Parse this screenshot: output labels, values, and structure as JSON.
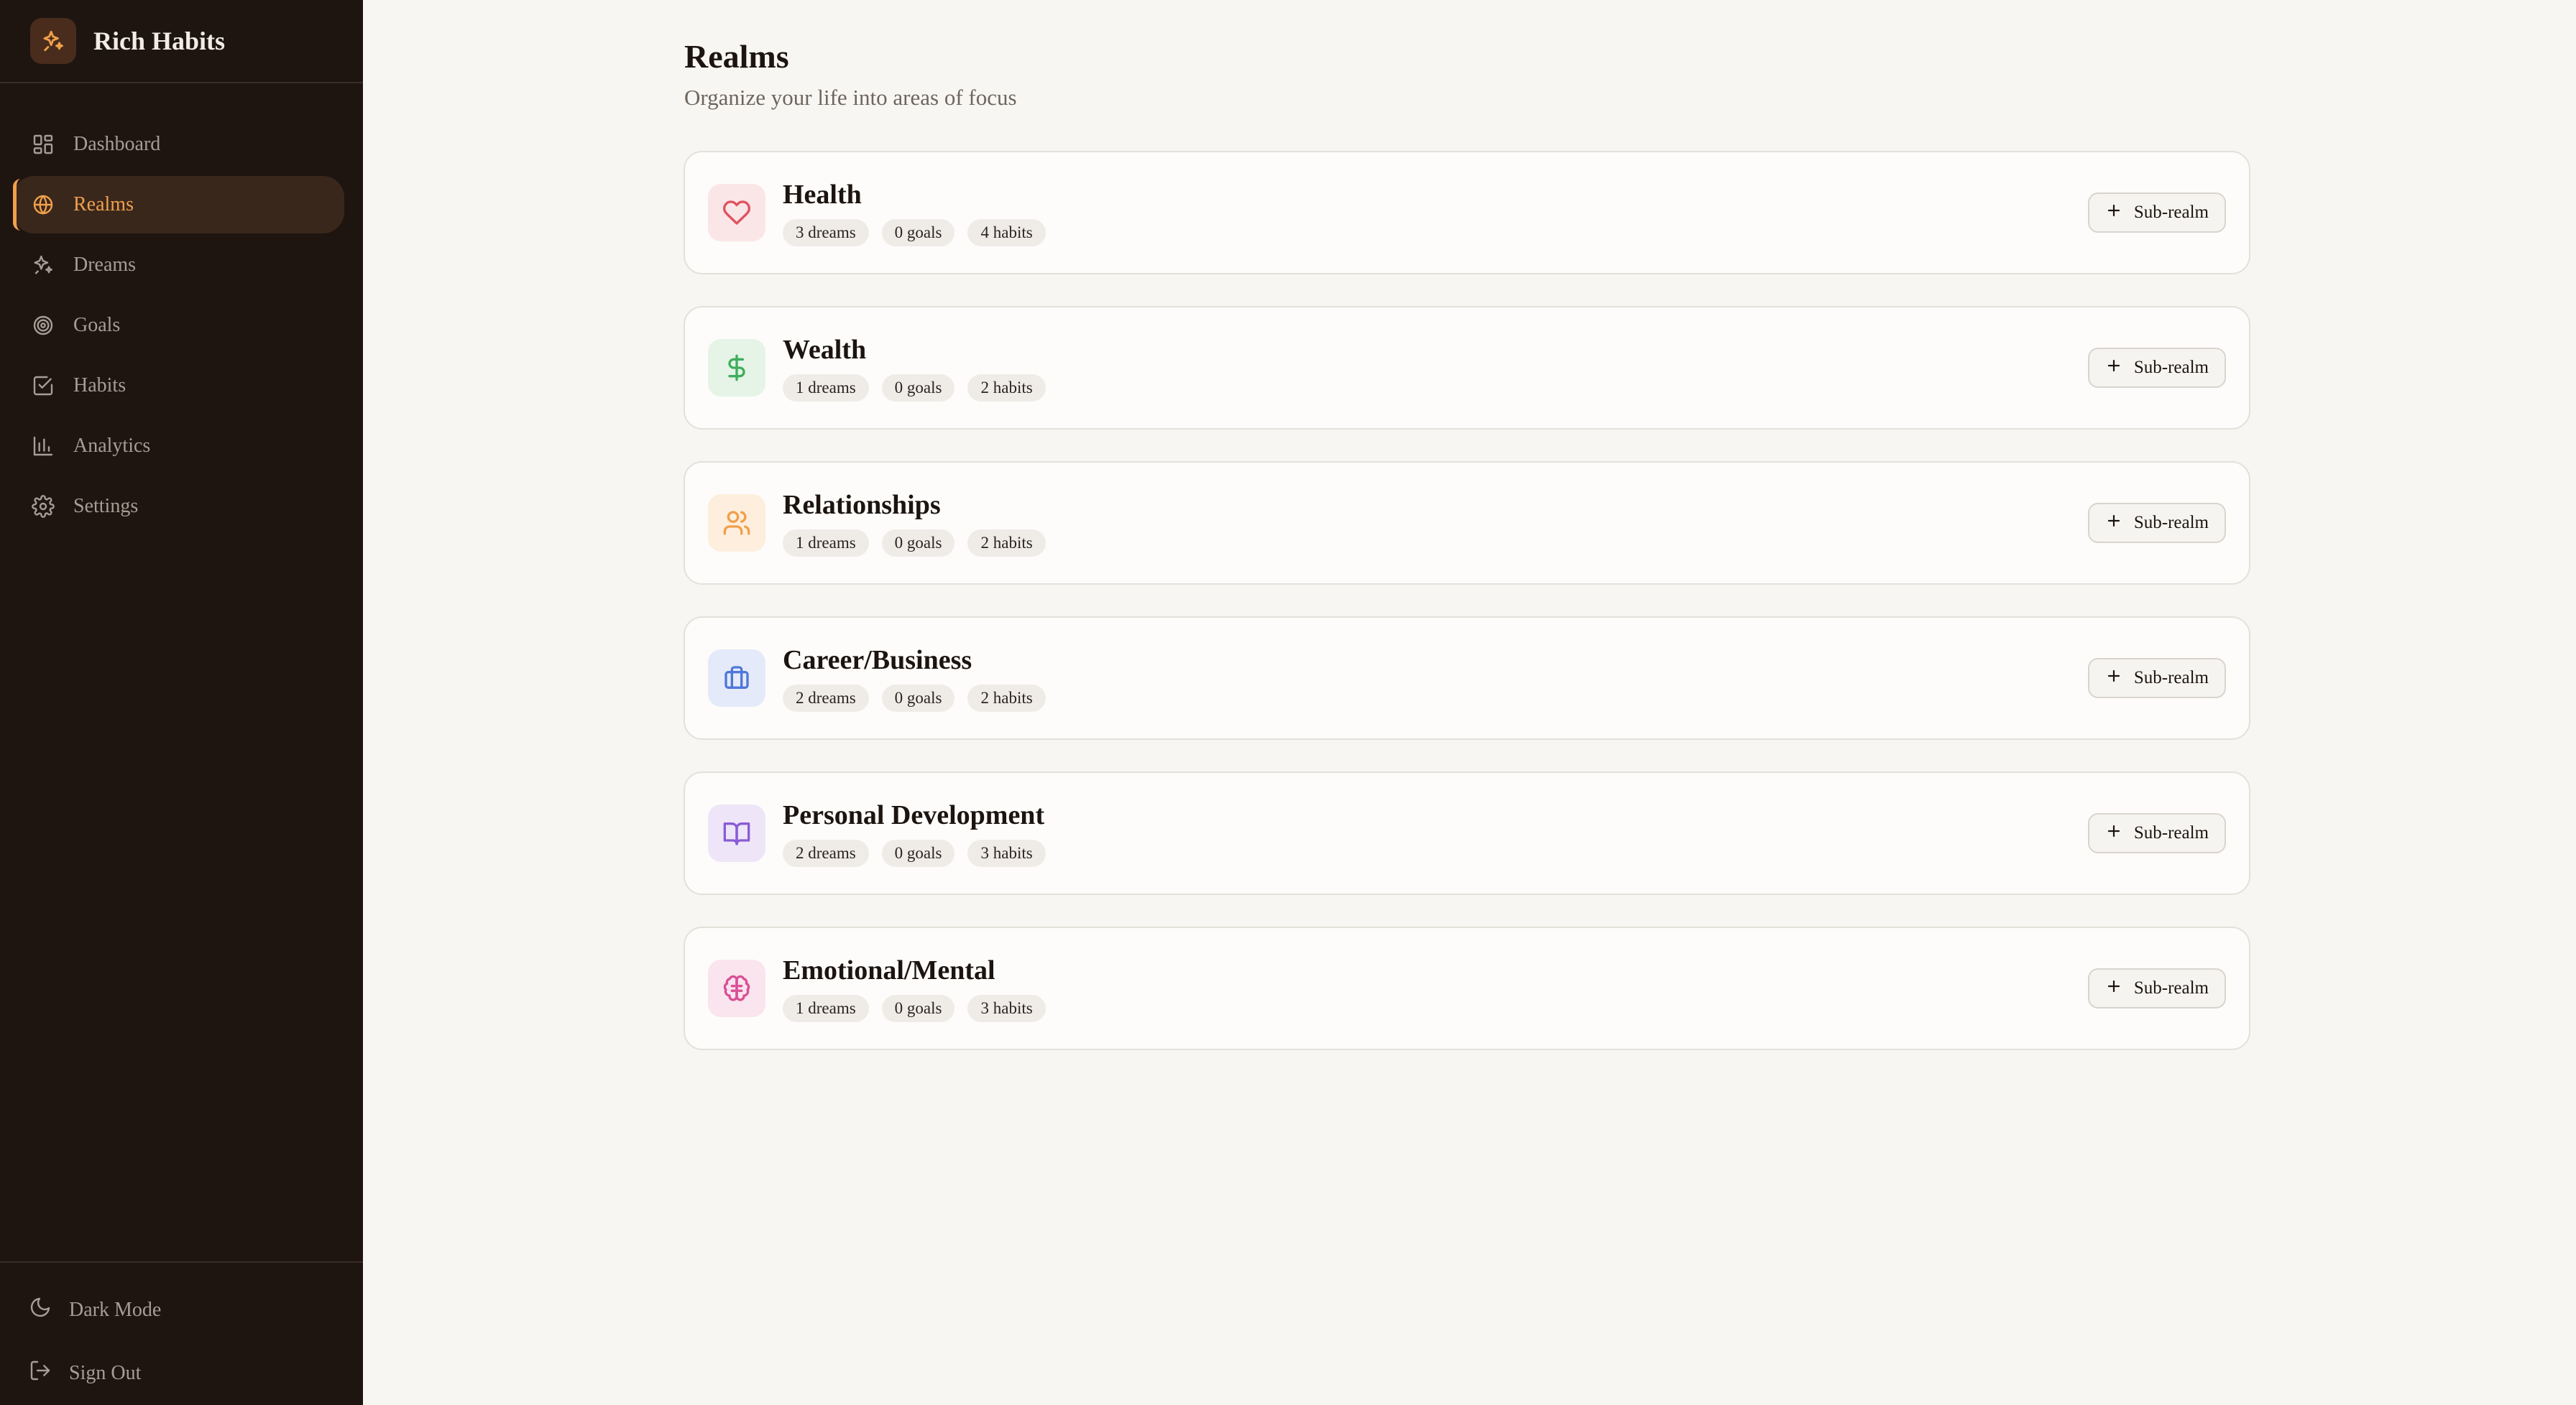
{
  "brand": {
    "name": "Rich Habits",
    "icon": "sparkles-icon"
  },
  "nav": [
    {
      "label": "Dashboard",
      "icon": "layout-dashboard-icon",
      "active": false
    },
    {
      "label": "Realms",
      "icon": "globe-icon",
      "active": true
    },
    {
      "label": "Dreams",
      "icon": "sparkles-icon",
      "active": false
    },
    {
      "label": "Goals",
      "icon": "target-icon",
      "active": false
    },
    {
      "label": "Habits",
      "icon": "check-square-icon",
      "active": false
    },
    {
      "label": "Analytics",
      "icon": "bar-chart-icon",
      "active": false
    },
    {
      "label": "Settings",
      "icon": "gear-icon",
      "active": false
    }
  ],
  "bottom": {
    "dark_mode": "Dark Mode",
    "sign_out": "Sign Out"
  },
  "page": {
    "title": "Realms",
    "subtitle": "Organize your life into areas of focus"
  },
  "sub_realm_label": "Sub-realm",
  "realms": [
    {
      "name": "Health",
      "icon": "heart-icon",
      "color": "#e0525f",
      "bg": "#fbe6e7",
      "dreams": "3 dreams",
      "goals": "0 goals",
      "habits": "4 habits"
    },
    {
      "name": "Wealth",
      "icon": "dollar-icon",
      "color": "#3fae5d",
      "bg": "#e5f4e7",
      "dreams": "1 dreams",
      "goals": "0 goals",
      "habits": "2 habits"
    },
    {
      "name": "Relationships",
      "icon": "users-icon",
      "color": "#f0a04b",
      "bg": "#fdeedd",
      "dreams": "1 dreams",
      "goals": "0 goals",
      "habits": "2 habits"
    },
    {
      "name": "Career/Business",
      "icon": "briefcase-icon",
      "color": "#4f77d9",
      "bg": "#e4eaf9",
      "dreams": "2 dreams",
      "goals": "0 goals",
      "habits": "2 habits"
    },
    {
      "name": "Personal Development",
      "icon": "book-open-icon",
      "color": "#8a5cd6",
      "bg": "#eee6f8",
      "dreams": "2 dreams",
      "goals": "0 goals",
      "habits": "3 habits"
    },
    {
      "name": "Emotional/Mental",
      "icon": "brain-icon",
      "color": "#d94f95",
      "bg": "#fae4ee",
      "dreams": "1 dreams",
      "goals": "0 goals",
      "habits": "3 habits"
    }
  ]
}
